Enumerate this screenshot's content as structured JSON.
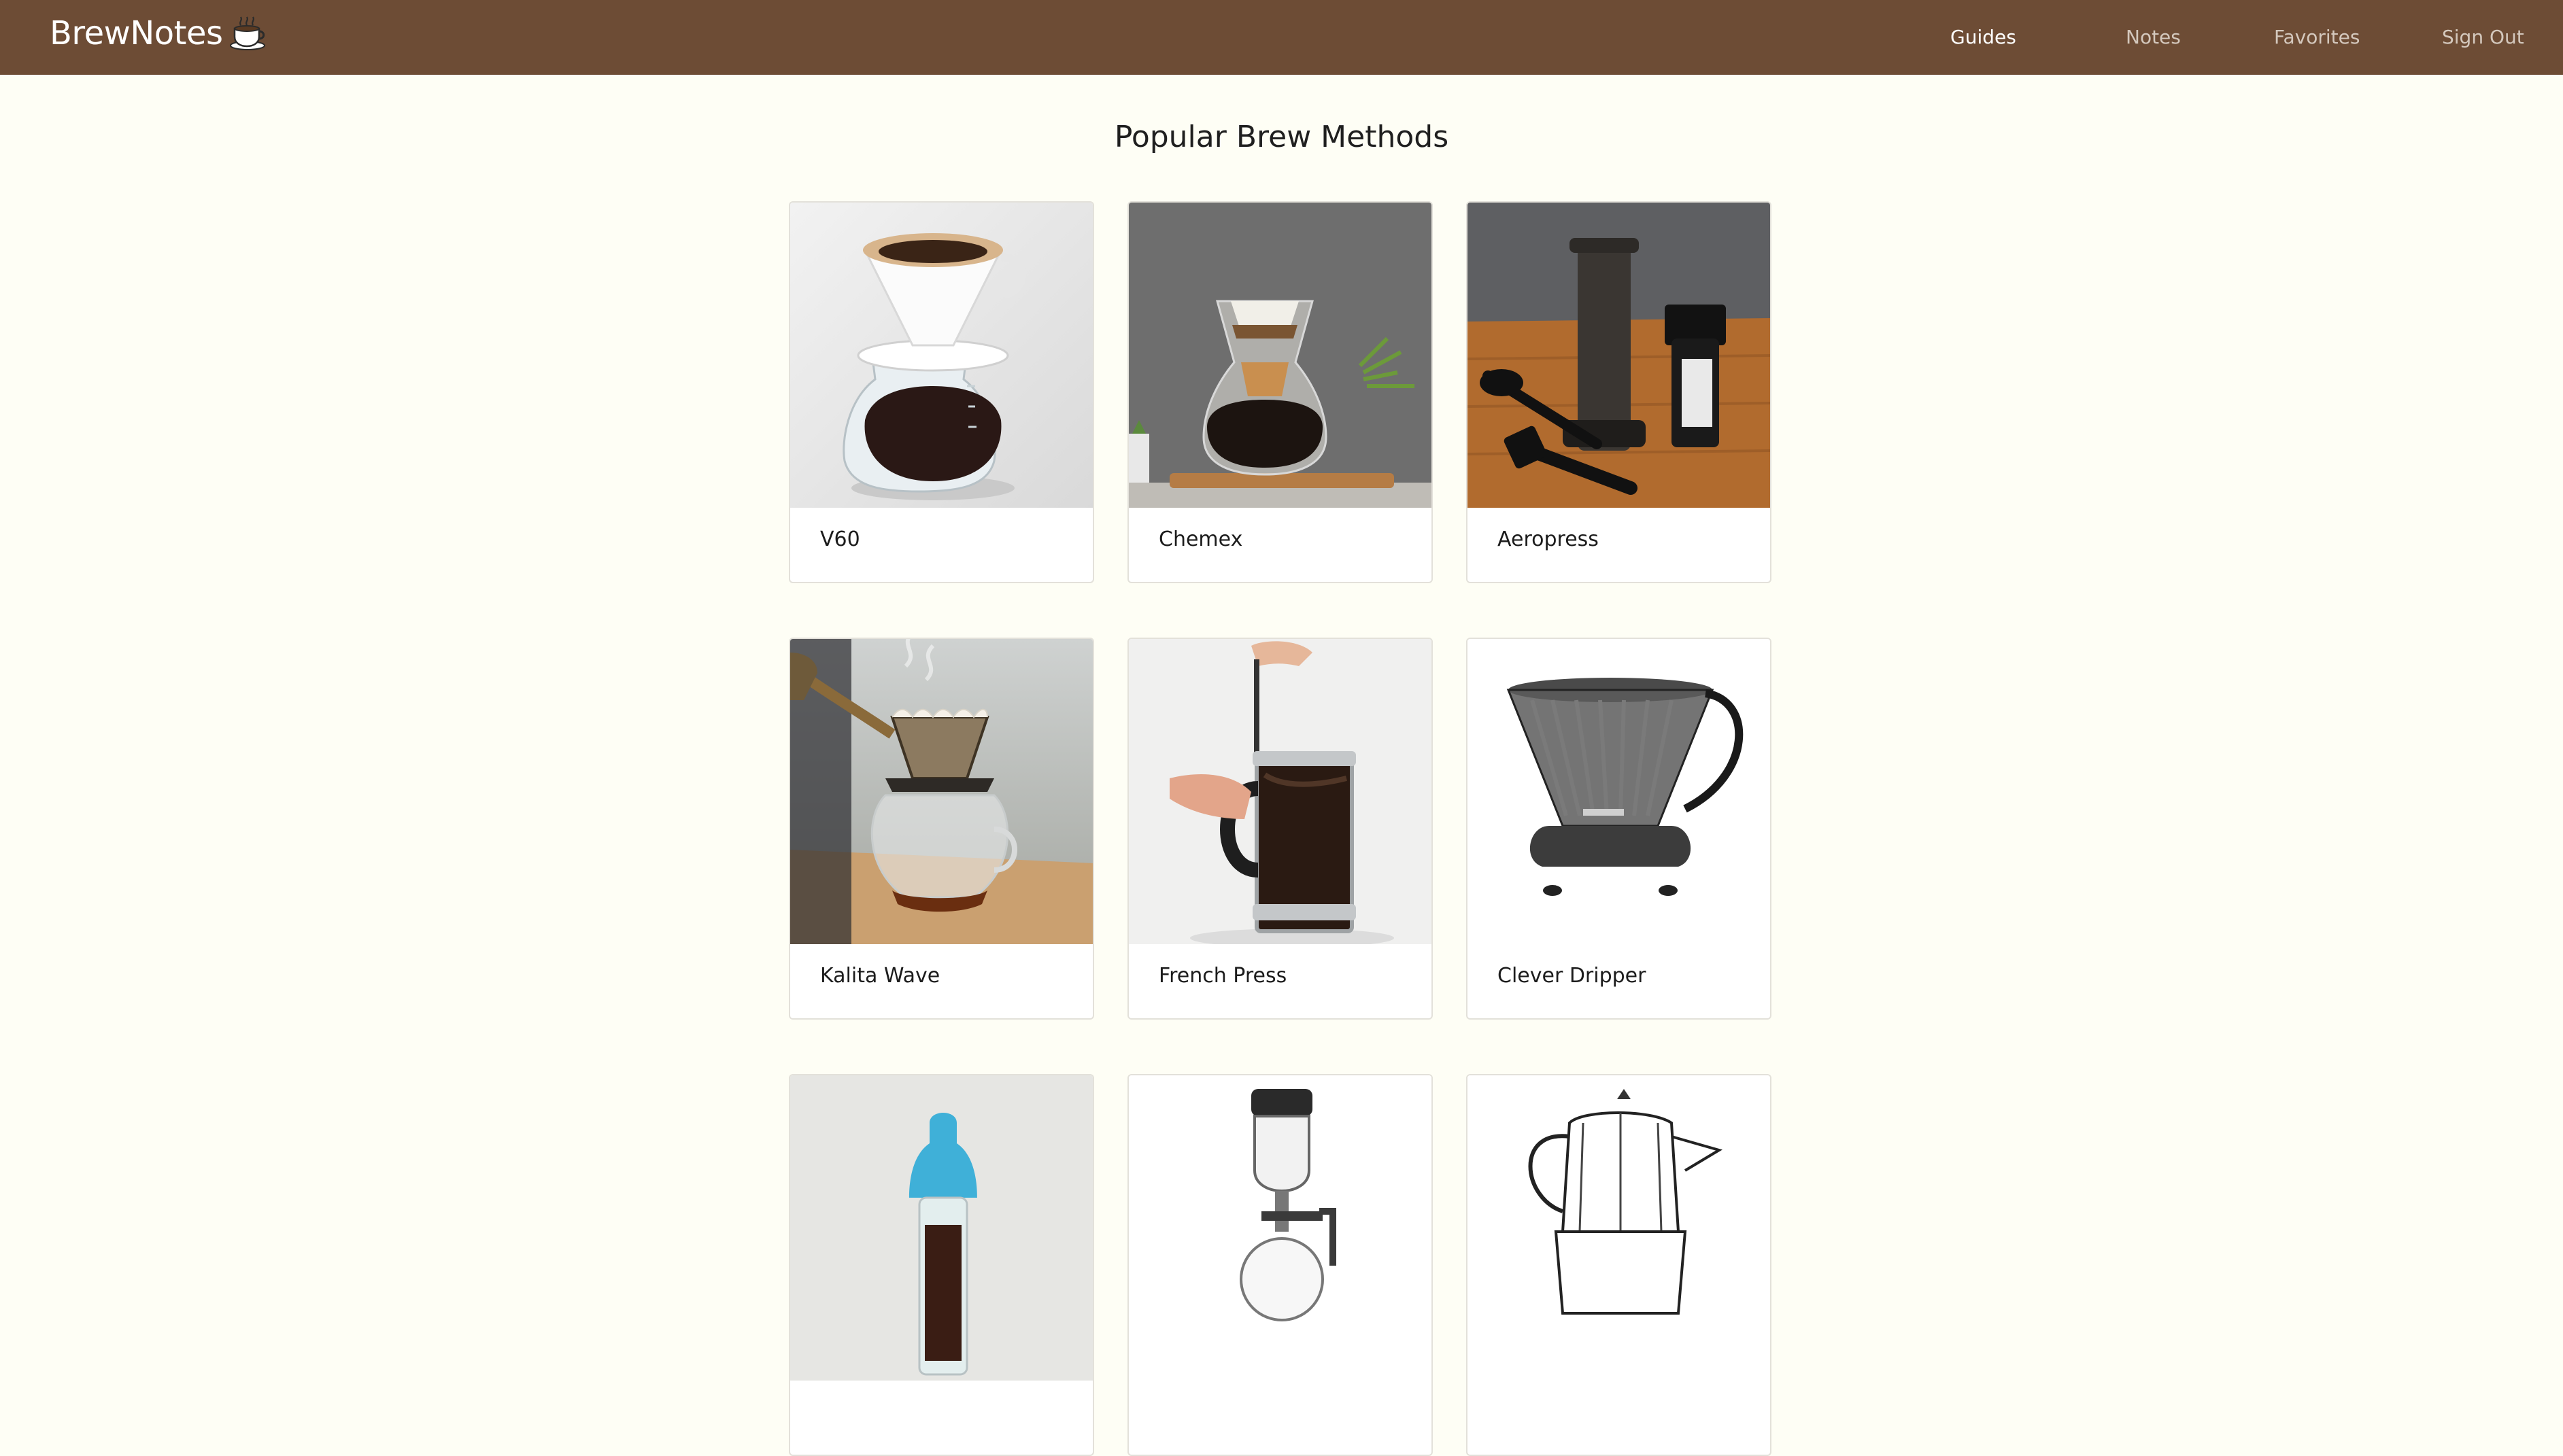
{
  "nav": {
    "brand": "BrewNotes",
    "brand_icon": "coffee-cup-icon",
    "links": [
      {
        "label": "Guides",
        "active": true
      },
      {
        "label": "Notes",
        "active": false
      },
      {
        "label": "Favorites",
        "active": false
      },
      {
        "label": "Sign Out",
        "active": false
      }
    ]
  },
  "page": {
    "title": "Popular Brew Methods"
  },
  "cards": [
    {
      "label": "V60"
    },
    {
      "label": "Chemex"
    },
    {
      "label": "Aeropress"
    },
    {
      "label": "Kalita Wave"
    },
    {
      "label": "French Press"
    },
    {
      "label": "Clever Dripper"
    },
    {
      "label": ""
    },
    {
      "label": ""
    },
    {
      "label": ""
    }
  ],
  "colors": {
    "navbar": "#6d4c35",
    "background": "#fefef5",
    "card_border": "#e3e1da"
  }
}
